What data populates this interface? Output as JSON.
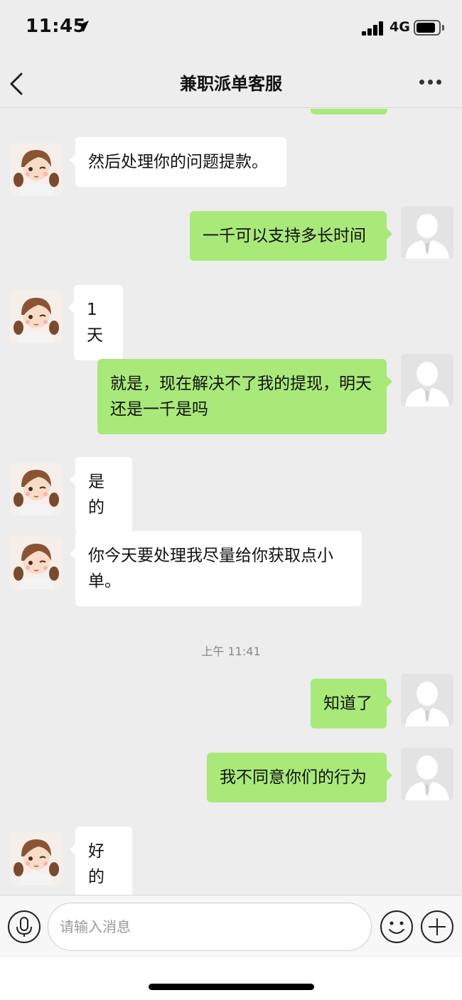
{
  "status_bar": {
    "time": "11:45",
    "network": "4G",
    "battery_level": 0.88
  },
  "nav": {
    "title": "兼职派单客服"
  },
  "chat": {
    "agent_avatar": "agent-avatar",
    "user_avatar": "user-avatar",
    "messages": [
      {
        "side": "left",
        "text": "然后处理你的问题提款。"
      },
      {
        "side": "right",
        "text": "一千可以支持多长时间"
      },
      {
        "side": "left",
        "text": "1天"
      },
      {
        "side": "right",
        "text": "就是，现在解决不了我的提现，明天还是一千是吗"
      },
      {
        "side": "left",
        "text": "是的"
      },
      {
        "side": "left",
        "text": "你今天要处理我尽量给你获取点小单。"
      },
      {
        "side": "timestamp",
        "text": "上午 11:41"
      },
      {
        "side": "right",
        "text": "知道了"
      },
      {
        "side": "right",
        "text": "我不同意你们的行为"
      },
      {
        "side": "left",
        "text": "好的"
      }
    ]
  },
  "input": {
    "placeholder": "请输入消息",
    "value": ""
  },
  "icons": {
    "voice": "microphone-icon",
    "emoji": "smiley-icon",
    "more": "plus-icon"
  }
}
